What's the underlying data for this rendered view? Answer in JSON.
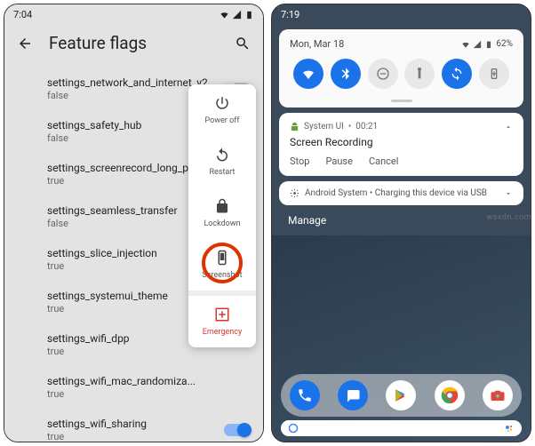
{
  "watermark": "wsxdn.com",
  "left": {
    "statusbar": {
      "time": "7:04"
    },
    "header": {
      "title": "Feature flags"
    },
    "flags": [
      {
        "name": "settings_network_and_internet_v2",
        "value": "false",
        "enabled": false,
        "show_toggle": true
      },
      {
        "name": "settings_safety_hub",
        "value": "false",
        "enabled": false,
        "show_toggle": false
      },
      {
        "name": "settings_screenrecord_long_p...",
        "value": "true",
        "enabled": false,
        "show_toggle": false
      },
      {
        "name": "settings_seamless_transfer",
        "value": "false",
        "enabled": false,
        "show_toggle": false
      },
      {
        "name": "settings_slice_injection",
        "value": "true",
        "enabled": false,
        "show_toggle": false
      },
      {
        "name": "settings_systemui_theme",
        "value": "true",
        "enabled": false,
        "show_toggle": false
      },
      {
        "name": "settings_wifi_dpp",
        "value": "true",
        "enabled": false,
        "show_toggle": false
      },
      {
        "name": "settings_wifi_mac_randomiza...",
        "value": "true",
        "enabled": false,
        "show_toggle": false
      },
      {
        "name": "settings_wifi_sharing",
        "value": "true",
        "enabled": true,
        "show_toggle": true
      }
    ],
    "power_menu": {
      "power_off": "Power off",
      "restart": "Restart",
      "lockdown": "Lockdown",
      "screenshot": "Screenshot",
      "emergency": "Emergency"
    }
  },
  "right": {
    "statusbar": {
      "time": "7:19"
    },
    "qs": {
      "date": "Mon, Mar 18",
      "battery": "62%"
    },
    "notif1": {
      "app": "System UI",
      "time": "00:21",
      "title": "Screen Recording",
      "actions": {
        "stop": "Stop",
        "pause": "Pause",
        "cancel": "Cancel"
      }
    },
    "notif2": {
      "text": "Android System • Charging this device via USB"
    },
    "manage": "Manage"
  }
}
